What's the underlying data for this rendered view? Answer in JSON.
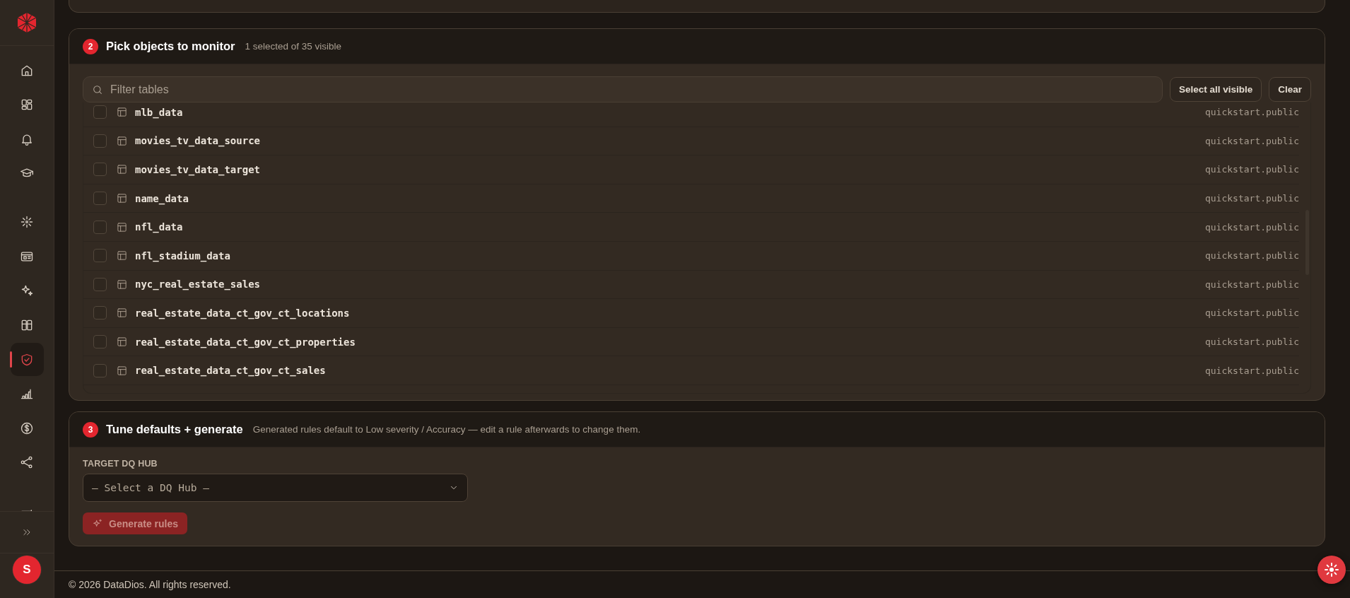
{
  "sidebar": {
    "groups": [
      {
        "items": [
          {
            "selected": false
          },
          {
            "selected": false
          },
          {
            "selected": false
          },
          {
            "selected": false
          }
        ]
      },
      {
        "items": [
          {
            "selected": false
          },
          {
            "selected": false
          },
          {
            "selected": false
          },
          {
            "selected": false
          },
          {
            "selected": true
          },
          {
            "selected": false
          },
          {
            "selected": false
          },
          {
            "selected": false
          }
        ]
      },
      {
        "items": [
          {
            "selected": false
          }
        ]
      }
    ],
    "avatar": "S"
  },
  "pick_objects": {
    "number": "2",
    "title": "Pick objects to monitor",
    "subtitle": "1 selected of 35 visible",
    "filter": {
      "placeholder": "Filter tables"
    },
    "buttons": [
      "Select all visible",
      "Clear"
    ],
    "tables": [
      {
        "name": "mlb_data",
        "schema": "quickstart.public",
        "checked": false
      },
      {
        "name": "movies_tv_data_source",
        "schema": "quickstart.public",
        "checked": false
      },
      {
        "name": "movies_tv_data_target",
        "schema": "quickstart.public",
        "checked": false
      },
      {
        "name": "name_data",
        "schema": "quickstart.public",
        "checked": false
      },
      {
        "name": "nfl_data",
        "schema": "quickstart.public",
        "checked": false
      },
      {
        "name": "nfl_stadium_data",
        "schema": "quickstart.public",
        "checked": false
      },
      {
        "name": "nyc_real_estate_sales",
        "schema": "quickstart.public",
        "checked": false
      },
      {
        "name": "real_estate_data_ct_gov_ct_locations",
        "schema": "quickstart.public",
        "checked": false
      },
      {
        "name": "real_estate_data_ct_gov_ct_properties",
        "schema": "quickstart.public",
        "checked": false
      },
      {
        "name": "real_estate_data_ct_gov_ct_sales",
        "schema": "quickstart.public",
        "checked": false
      }
    ]
  },
  "tune_defaults": {
    "number": "3",
    "title": "Tune defaults + generate",
    "subtitle": "Generated rules default to Low severity / Accuracy — edit a rule afterwards to change them.",
    "hub_label": "TARGET DQ HUB",
    "hub_select": {
      "placeholder": "— Select a DQ Hub —"
    },
    "generate_button": {
      "label": "Generate rules",
      "disabled": true
    }
  },
  "footer": "© 2026 DataDios. All rights reserved."
}
